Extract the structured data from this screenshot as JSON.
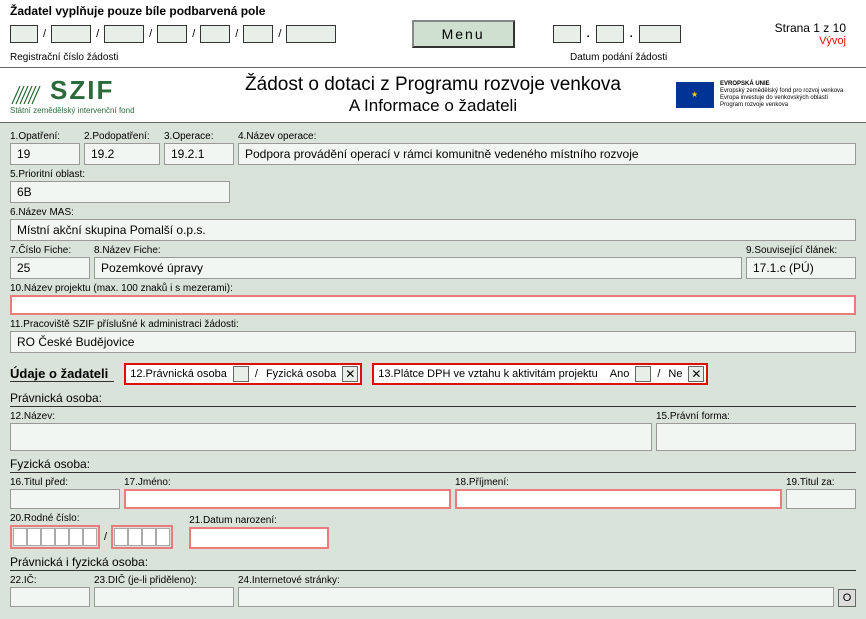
{
  "top_instruction": "Žadatel vyplňuje pouze bíle podbarvená pole",
  "reg_label": "Registrační číslo žádosti",
  "menu_label": "Menu",
  "date_label": "Datum podání žádosti",
  "page_info": "Strana 1 z 10",
  "mode": "Vývoj",
  "szif": {
    "abbr": "SZIF",
    "sub": "Státní zemědělský intervenční fond"
  },
  "title1": "Žádost o dotaci z Programu rozvoje venkova",
  "title2": "A Informace o žadateli",
  "eu": {
    "l1": "EVROPSKÁ UNIE",
    "l2": "Evropský zemědělský fond pro rozvoj venkova",
    "l3": "Evropa investuje do venkovských oblastí",
    "l4": "Program rozvoje venkova"
  },
  "f": {
    "l1": "1.Opatření:",
    "v1": "19",
    "l2": "2.Podopatření:",
    "v2": "19.2",
    "l3": "3.Operace:",
    "v3": "19.2.1",
    "l4": "4.Název operace:",
    "v4": "Podpora provádění operací v rámci komunitně vedeného místního rozvoje",
    "l5": "5.Prioritní oblast:",
    "v5": "6B",
    "l6": "6.Název MAS:",
    "v6": "Místní akční skupina Pomalší o.p.s.",
    "l7": "7.Číslo Fiche:",
    "v7": "25",
    "l8": "8.Název Fiche:",
    "v8": "Pozemkové úpravy",
    "l9": "9.Související článek:",
    "v9": "17.1.c (PÚ)",
    "l10": "10.Název projektu (max. 100 znaků i s mezerami):",
    "v10": "",
    "l11": "11.Pracoviště SZIF příslušné k administraci žádosti:",
    "v11": "RO České Budějovice"
  },
  "section2": "Údaje o žadateli",
  "tog12": {
    "label": "12.Právnická osoba",
    "sep": "/",
    "alt": "Fyzická osoba",
    "sel": "fyzicka"
  },
  "tog13": {
    "label": "13.Plátce DPH ve vztahu k aktivitám projektu",
    "yes": "Ano",
    "sep": "/",
    "no": "Ne",
    "sel": "ne"
  },
  "pravnicka_title": "Právnická osoba:",
  "l12n": "12.Název:",
  "l15": "15.Právní forma:",
  "fyzicka_title": "Fyzická osoba:",
  "l16": "16.Titul před:",
  "l17": "17.Jméno:",
  "l18": "18.Příjmení:",
  "l19": "19.Titul za:",
  "l20": "20.Rodné číslo:",
  "l21": "21.Datum narození:",
  "both_title": "Právnická i fyzická osoba:",
  "l22": "22.IČ:",
  "l23": "23.DIČ (je-li přiděleno):",
  "l24": "24.Internetové stránky:",
  "o_btn": "O"
}
